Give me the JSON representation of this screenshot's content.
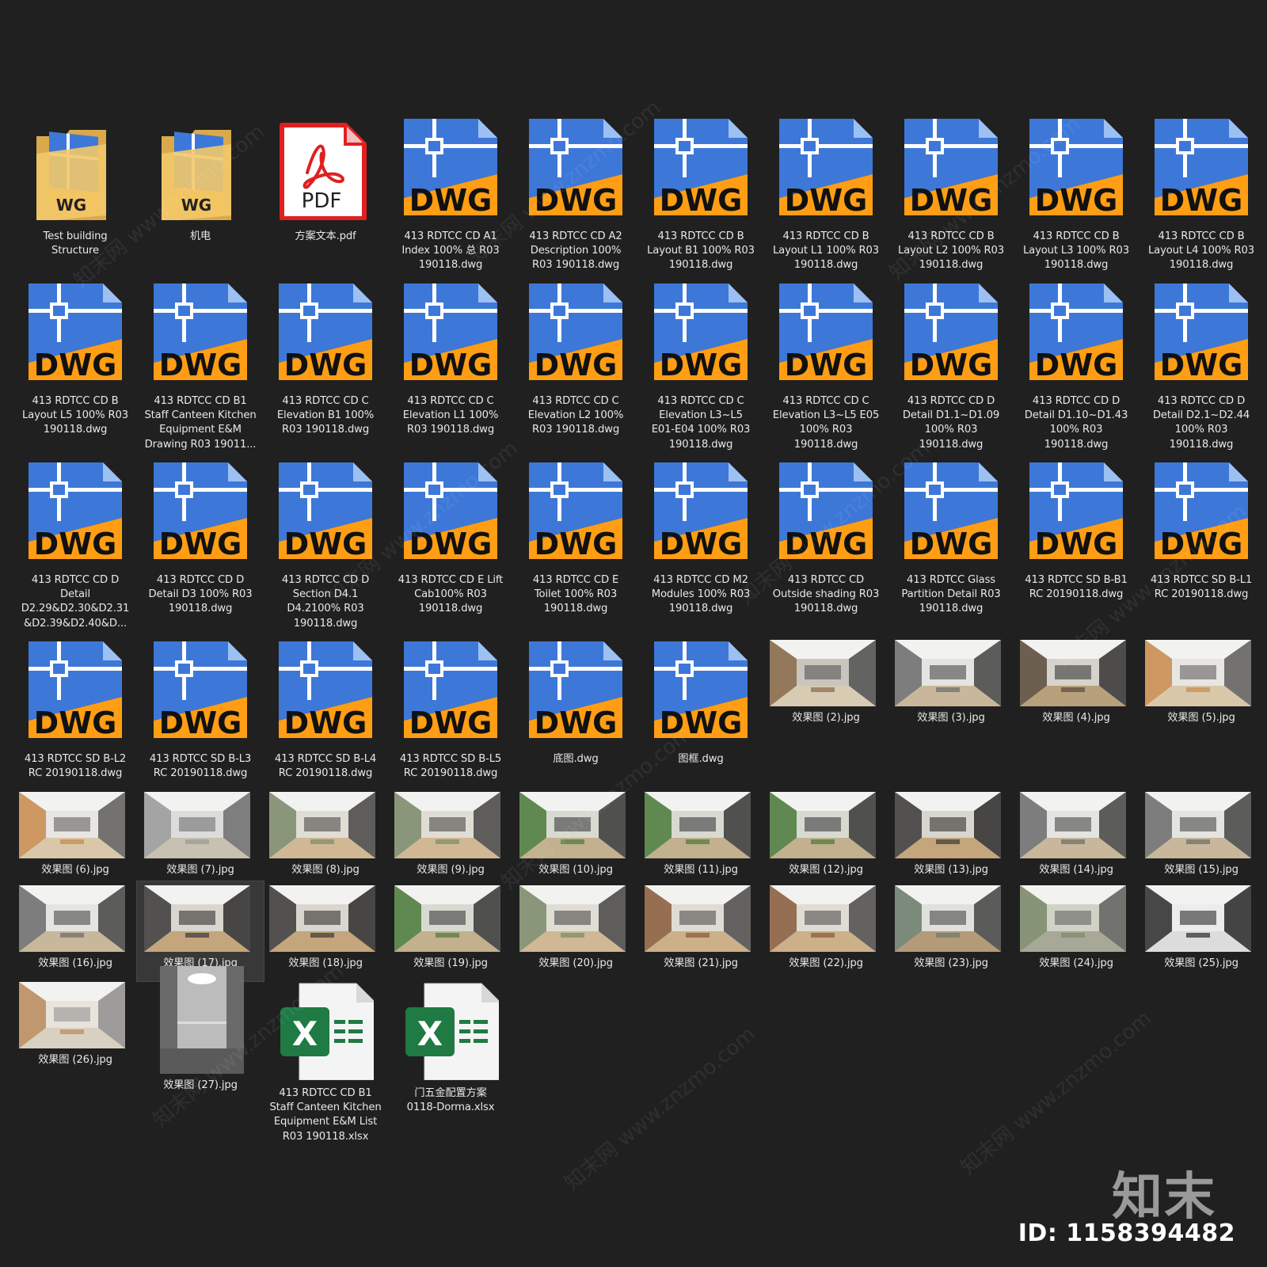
{
  "watermark": {
    "id_text": "ID: 1158394482",
    "logo_text": "知末",
    "diagonal_text": "知末网 www.znzmo.com"
  },
  "items": [
    {
      "type": "folder",
      "name": "Test building\nStructure"
    },
    {
      "type": "folder",
      "name": "机电"
    },
    {
      "type": "pdf",
      "name": "方案文本.pdf"
    },
    {
      "type": "dwg",
      "name": "413 RDTCC CD A1\nIndex 100% 总 R03\n190118.dwg"
    },
    {
      "type": "dwg",
      "name": "413 RDTCC CD A2\nDescription 100%\nR03  190118.dwg"
    },
    {
      "type": "dwg",
      "name": "413 RDTCC CD B\nLayout B1 100% R03\n190118.dwg"
    },
    {
      "type": "dwg",
      "name": "413 RDTCC CD B\nLayout L1 100% R03\n190118.dwg"
    },
    {
      "type": "dwg",
      "name": "413 RDTCC CD B\nLayout L2 100% R03\n190118.dwg"
    },
    {
      "type": "dwg",
      "name": "413 RDTCC CD B\nLayout L3 100% R03\n190118.dwg"
    },
    {
      "type": "dwg",
      "name": "413 RDTCC CD B\nLayout L4 100% R03\n190118.dwg"
    },
    {
      "type": "dwg",
      "name": "413 RDTCC CD B\nLayout L5 100% R03\n190118.dwg"
    },
    {
      "type": "dwg",
      "name": "413 RDTCC CD B1\nStaff Canteen Kitchen\nEquipment E&M\nDrawing R03 19011..."
    },
    {
      "type": "dwg",
      "name": "413 RDTCC CD C\nElevation B1 100%\nR03  190118.dwg"
    },
    {
      "type": "dwg",
      "name": "413 RDTCC CD C\nElevation L1 100%\nR03  190118.dwg"
    },
    {
      "type": "dwg",
      "name": "413 RDTCC CD C\nElevation L2 100%\nR03  190118.dwg"
    },
    {
      "type": "dwg",
      "name": "413 RDTCC CD C\nElevation L3~L5\nE01-E04  100% R03\n190118.dwg"
    },
    {
      "type": "dwg",
      "name": "413 RDTCC CD C\nElevation L3~L5 E05\n100% R03\n190118.dwg"
    },
    {
      "type": "dwg",
      "name": "413 RDTCC CD D\nDetail D1.1~D1.09\n100% R03\n190118.dwg"
    },
    {
      "type": "dwg",
      "name": "413 RDTCC CD D\nDetail D1.10~D1.43\n100% R03\n190118.dwg"
    },
    {
      "type": "dwg",
      "name": "413 RDTCC CD D\nDetail D2.1~D2.44\n100% R03\n190118.dwg"
    },
    {
      "type": "dwg",
      "name": "413 RDTCC CD D\nDetail\nD2.29&D2.30&D2.31\n&D2.39&D2.40&D..."
    },
    {
      "type": "dwg",
      "name": "413 RDTCC CD D\nDetail D3 100% R03\n190118.dwg"
    },
    {
      "type": "dwg",
      "name": "413 RDTCC CD D\nSection D4.1\nD4.2100% R03\n190118.dwg"
    },
    {
      "type": "dwg",
      "name": "413 RDTCC CD E Lift\nCab100% R03\n190118.dwg"
    },
    {
      "type": "dwg",
      "name": "413 RDTCC CD E\nToilet 100% R03\n190118.dwg"
    },
    {
      "type": "dwg",
      "name": "413 RDTCC CD M2\nModules 100% R03\n190118.dwg"
    },
    {
      "type": "dwg",
      "name": "413 RDTCC CD\nOutside shading R03\n190118.dwg"
    },
    {
      "type": "dwg",
      "name": "413 RDTCC Glass\nPartition Detail R03\n190118.dwg"
    },
    {
      "type": "dwg",
      "name": "413 RDTCC SD B-B1\nRC 20190118.dwg"
    },
    {
      "type": "dwg",
      "name": "413 RDTCC SD B-L1\nRC 20190118.dwg"
    },
    {
      "type": "dwg",
      "name": "413 RDTCC SD B-L2\nRC 20190118.dwg"
    },
    {
      "type": "dwg",
      "name": "413 RDTCC SD B-L3\nRC 20190118.dwg"
    },
    {
      "type": "dwg",
      "name": "413 RDTCC SD B-L4\nRC 20190118.dwg"
    },
    {
      "type": "dwg",
      "name": "413 RDTCC SD B-L5\nRC 20190118.dwg"
    },
    {
      "type": "dwg",
      "name": "底图.dwg"
    },
    {
      "type": "dwg",
      "name": "图框.dwg"
    },
    {
      "type": "jpg",
      "name": "效果图 (2).jpg",
      "scene": "corridor"
    },
    {
      "type": "jpg",
      "name": "效果图 (3).jpg",
      "scene": "open-office"
    },
    {
      "type": "jpg",
      "name": "效果图 (4).jpg",
      "scene": "meeting"
    },
    {
      "type": "jpg",
      "name": "效果图 (5).jpg",
      "scene": "lounge"
    },
    {
      "type": "jpg",
      "name": "效果图 (6).jpg",
      "scene": "lounge"
    },
    {
      "type": "jpg",
      "name": "效果图 (7).jpg",
      "scene": "glass-room"
    },
    {
      "type": "jpg",
      "name": "效果图 (8).jpg",
      "scene": "cafe"
    },
    {
      "type": "jpg",
      "name": "效果图 (9).jpg",
      "scene": "cafe"
    },
    {
      "type": "jpg",
      "name": "效果图 (10).jpg",
      "scene": "garden"
    },
    {
      "type": "jpg",
      "name": "效果图 (11).jpg",
      "scene": "garden"
    },
    {
      "type": "jpg",
      "name": "效果图 (12).jpg",
      "scene": "garden"
    },
    {
      "type": "jpg",
      "name": "效果图 (13).jpg",
      "scene": "stair"
    },
    {
      "type": "jpg",
      "name": "效果图 (14).jpg",
      "scene": "open-office"
    },
    {
      "type": "jpg",
      "name": "效果图 (15).jpg",
      "scene": "open-office"
    },
    {
      "type": "jpg",
      "name": "效果图 (16).jpg",
      "scene": "open-office"
    },
    {
      "type": "jpg",
      "name": "效果图 (17).jpg",
      "scene": "stair",
      "selected": true
    },
    {
      "type": "jpg",
      "name": "效果图 (18).jpg",
      "scene": "stair"
    },
    {
      "type": "jpg",
      "name": "效果图 (19).jpg",
      "scene": "garden"
    },
    {
      "type": "jpg",
      "name": "效果图 (20).jpg",
      "scene": "cafe"
    },
    {
      "type": "jpg",
      "name": "效果图 (21).jpg",
      "scene": "canteen"
    },
    {
      "type": "jpg",
      "name": "效果图 (22).jpg",
      "scene": "canteen"
    },
    {
      "type": "jpg",
      "name": "效果图 (23).jpg",
      "scene": "gym"
    },
    {
      "type": "jpg",
      "name": "效果图 (24).jpg",
      "scene": "lockers"
    },
    {
      "type": "jpg",
      "name": "效果图 (25).jpg",
      "scene": "washroom"
    },
    {
      "type": "jpg",
      "name": "效果图 (26).jpg",
      "scene": "toilet"
    },
    {
      "type": "jpg",
      "name": "效果图 (27).jpg",
      "scene": "lift",
      "portrait": true
    },
    {
      "type": "xlsx",
      "name": "413 RDTCC CD B1\nStaff Canteen Kitchen\nEquipment E&M List\nR03 190118.xlsx"
    },
    {
      "type": "xlsx",
      "name": "门五金配置方案\n0118-Dorma.xlsx"
    }
  ],
  "labels": {
    "dwg": "DWG",
    "pdf": "PDF",
    "xlsx": "X"
  },
  "colors": {
    "background": "#202020",
    "dwg_blue": "#3d78d8",
    "dwg_orange": "#ff9e14",
    "folder": "#f2c86a",
    "pdf_red": "#e02020",
    "excel_green": "#1f7a44"
  }
}
